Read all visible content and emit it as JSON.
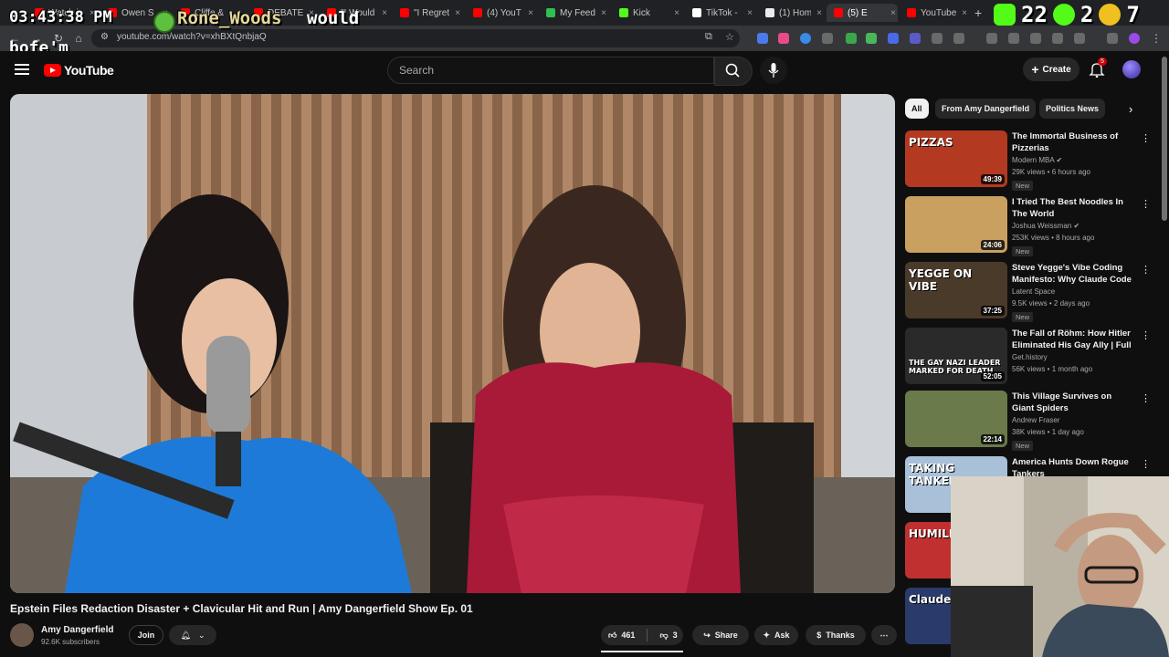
{
  "overlay": {
    "clock": "03:43:38 PM",
    "chat_user": "Rone_Woods",
    "chat_message_1": "would",
    "chat_message_2": "bofe'm",
    "stat_a": "22",
    "stat_b": "2",
    "stat_c": "7"
  },
  "browser": {
    "tabs": [
      {
        "label": "Watch l",
        "color": "#ff0000"
      },
      {
        "label": "Owen S",
        "color": "#ff0000"
      },
      {
        "label": "Cliffe &",
        "color": "#ff0000"
      },
      {
        "label": "DEBATE",
        "color": "#ff0000"
      },
      {
        "label": "\"I Would",
        "color": "#ff0000"
      },
      {
        "label": "\"I Regret",
        "color": "#ff0000"
      },
      {
        "label": "(4) YouT",
        "color": "#ff0000"
      },
      {
        "label": "My Feed",
        "color": "#2fbf4f"
      },
      {
        "label": "Kick",
        "color": "#53fc18"
      },
      {
        "label": "TikTok -",
        "color": "#ffffff"
      },
      {
        "label": "(1) Hom",
        "color": "#e8eaed"
      },
      {
        "label": "(5) E",
        "color": "#ff0000"
      },
      {
        "label": "YouTube",
        "color": "#ff0000"
      }
    ],
    "url": "youtube.com/watch?v=xhBXtQnbjaQ"
  },
  "header": {
    "logo": "YouTube",
    "search_placeholder": "Search",
    "create_label": "Create",
    "notif_count": "5"
  },
  "video": {
    "title": "Epstein Files Redaction Disaster + Clavicular Hit and Run | Amy Dangerfield Show Ep. 01",
    "channel": "Amy Dangerfield",
    "subscribers": "92.6K subscribers",
    "join_label": "Join",
    "likes": "461",
    "dislikes": "3",
    "share_label": "Share",
    "ask_label": "Ask",
    "thanks_label": "Thanks"
  },
  "sidebar": {
    "chips": [
      "All",
      "From Amy Dangerfield",
      "Politics News"
    ],
    "recommendations": [
      {
        "title": "The Immortal Business of Pizzerias",
        "channel": "Modern MBA",
        "verified": true,
        "meta": "29K views • 6 hours ago",
        "badge": "New",
        "duration": "49:39",
        "thumb_color": "#b33a20",
        "thumb_text": "PIZZAS"
      },
      {
        "title": "I Tried The Best Noodles In The World",
        "channel": "Joshua Weissman",
        "verified": true,
        "meta": "253K views • 8 hours ago",
        "badge": "New",
        "duration": "24:06",
        "thumb_color": "#c9a060",
        "thumb_text": ""
      },
      {
        "title": "Steve Yegge's Vibe Coding Manifesto: Why Claude Code ...",
        "channel": "Latent Space",
        "verified": false,
        "meta": "9.5K views • 2 days ago",
        "badge": "New",
        "duration": "37:25",
        "thumb_color": "#4a3a2a",
        "thumb_text": "YEGGE ON VIBE"
      },
      {
        "title": "The Fall of Röhm: How Hitler Eliminated His Gay Ally | Full ...",
        "channel": "Get.history",
        "verified": false,
        "meta": "56K views • 1 month ago",
        "badge": "",
        "duration": "52:05",
        "thumb_color": "#2a2a2a",
        "thumb_text": "THE GAY NAZI LEADER MARKED FOR DEATH"
      },
      {
        "title": "This Village Survives on Giant Spiders",
        "channel": "Andrew Fraser",
        "verified": false,
        "meta": "38K views • 1 day ago",
        "badge": "New",
        "duration": "22:14",
        "thumb_color": "#6a7a4a",
        "thumb_text": ""
      },
      {
        "title": "America Hunts Down Rogue Tankers",
        "channel": "",
        "verified": false,
        "meta": "",
        "badge": "",
        "duration": "",
        "thumb_color": "#a8c0d8",
        "thumb_text": "TAKING TANKERS"
      },
      {
        "title": "",
        "channel": "",
        "verified": false,
        "meta": "",
        "badge": "",
        "duration": "",
        "thumb_color": "#c03030",
        "thumb_text": "HUMILIA"
      },
      {
        "title": "",
        "channel": "",
        "verified": false,
        "meta": "",
        "badge": "",
        "duration": "",
        "thumb_color": "#2a3a6a",
        "thumb_text": "Claude"
      }
    ]
  },
  "colors": {
    "accent_red": "#ff0000",
    "page_bg": "#0f0f0f"
  }
}
